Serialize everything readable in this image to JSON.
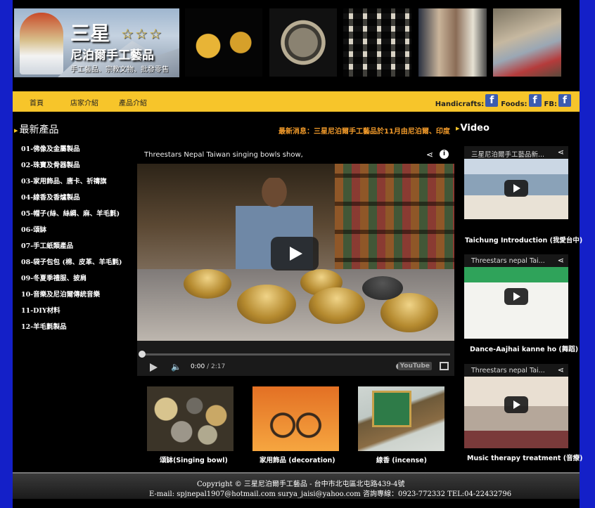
{
  "logo": {
    "title": "三星",
    "stars": "☆☆☆",
    "subtitle": "尼泊爾手工藝品",
    "tagline": "手工藝品、宗教文物、批發零售"
  },
  "nav": {
    "items": [
      "首頁",
      "店家介紹",
      "產品介紹"
    ],
    "social": [
      "Handicrafts:",
      "Foods:",
      "FB:"
    ],
    "fb_glyph": "f"
  },
  "sidebar": {
    "title": "最新產品",
    "items": [
      "01-佛像及金屬製品",
      "02-珠寶及骨器製品",
      "03-家用飾品、唐卡、祈禱旗",
      "04-線香及香爐製品",
      "05-帽子(絲、絲綢、麻、羊毛氈)",
      "06-頌缽",
      "07-手工紙類產品",
      "08-袋子包包 (棉、皮革、羊毛氈)",
      "09-冬夏季禮服、披肩",
      "10-音樂及尼泊爾傳統音樂",
      "11-DIY材料",
      "12-羊毛氈製品"
    ]
  },
  "news": "最新消息：三星尼泊爾手工藝品於11月由尼泊爾、印度",
  "video_heading": "Video",
  "main_video": {
    "title": "Threestars Nepal Taiwan singing bowls show,",
    "share_glyph": "⋖",
    "info_glyph": "i",
    "current_time": "0:00",
    "duration": "/ 2:17",
    "volume_glyph": "🔈",
    "youtube_label": "YouTube"
  },
  "products": [
    {
      "label": "頌缽(Singing bowl)"
    },
    {
      "label": "家用飾品 (decoration)"
    },
    {
      "label": "線香 (incense)"
    }
  ],
  "side_videos": [
    {
      "title": "三星尼泊爾手工藝品新...",
      "label": "Taichung Introduction (我愛台中)"
    },
    {
      "title": "Threestars nepal Tai...",
      "label": "Dance-Aajhai kanne ho (舞蹈)"
    },
    {
      "title": "Threestars nepal Tai...",
      "label": "Music therapy treatment (音療)"
    }
  ],
  "footer": {
    "line1": "Copyright © 三星尼泊爾手工藝品 - 台中市北屯區北屯路439-4號",
    "line2": "E-mail: spjnepal1907@hotmail.com surya_jaisi@yahoo.com 咨詢專線：0923-772332 TEL:04-22432796"
  }
}
